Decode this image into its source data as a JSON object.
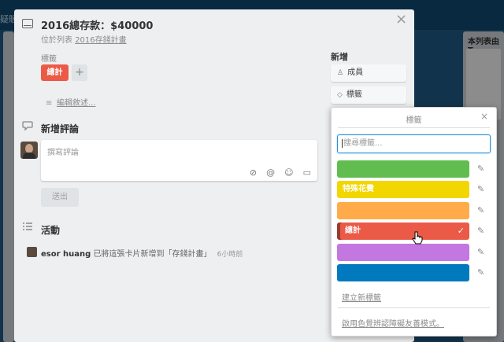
{
  "background": {
    "breadcrumb": "疑販",
    "list_right_title": "本列表由T"
  },
  "card": {
    "title": "2016總存款：$40000",
    "in_list_prefix": "位於列表",
    "in_list_name": "2016存錢計畫",
    "close": "×"
  },
  "labels_section": {
    "caption": "標籤",
    "applied_label": "總計",
    "add": "+"
  },
  "description": {
    "edit_link": "編輯敘述..."
  },
  "comment": {
    "heading": "新增評論",
    "placeholder": "撰寫評論",
    "submit": "送出"
  },
  "activity": {
    "heading": "活動",
    "user": "esor huang",
    "text": "已將這張卡片新增到「存錢計畫」",
    "time": "6小時前"
  },
  "sidebar": {
    "add_title": "新增",
    "members": "成員",
    "labels": "標籤"
  },
  "label_popover": {
    "title": "標籤",
    "close": "×",
    "search_placeholder": "搜尋標籤...",
    "labels": [
      {
        "name": "",
        "color": "#61bd4f",
        "selected": false
      },
      {
        "name": "特殊花費",
        "color": "#f2d600",
        "selected": false
      },
      {
        "name": "",
        "color": "#ffab4a",
        "selected": false
      },
      {
        "name": "總計",
        "color": "#eb5a46",
        "selected": true
      },
      {
        "name": "",
        "color": "#c377e0",
        "selected": false
      },
      {
        "name": "",
        "color": "#0079bf",
        "selected": false
      }
    ],
    "create_link": "建立新標籤",
    "colorblind_link": "啟用色覺辨認障礙友善模式。"
  },
  "colors": {
    "accent": "#2a8fd7",
    "label_red": "#eb5a46"
  }
}
